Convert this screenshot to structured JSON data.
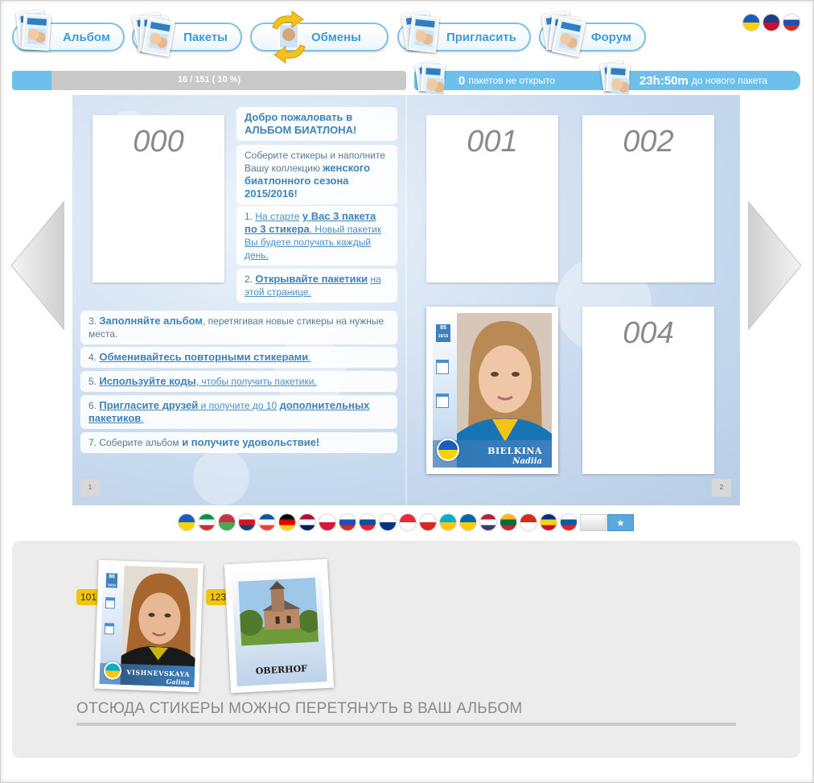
{
  "nav": {
    "album": "Альбом",
    "packs": "Пакеты",
    "exchanges": "Обмены",
    "invite": "Пригласить",
    "forum": "Форум"
  },
  "languages": [
    {
      "name": "ukraine-flag-icon",
      "colors": [
        "#1a5dc0",
        "#f7d300"
      ]
    },
    {
      "name": "uk-flag-icon",
      "colors": [
        "#1b3f8a",
        "#c8102e"
      ]
    },
    {
      "name": "russia-flag-icon",
      "colors": [
        "#ffffff",
        "#1d4fb8",
        "#d52b1e"
      ]
    }
  ],
  "progress": {
    "text": "16 / 151 ( 10 %)",
    "fraction": 0.1
  },
  "packs_status": {
    "count": "0",
    "label": "пакетов не открыто"
  },
  "timer": {
    "value": "23h:50m",
    "label": "до нового пакета"
  },
  "album": {
    "slots": {
      "s000": "000",
      "s001": "001",
      "s002": "002",
      "s004": "004"
    },
    "welcome": {
      "title": "Добро пожаловать в АЛЬБОМ БИАТЛОНА!",
      "intro_plain": "Соберите стикеры и наполните Вашу коллекцию",
      "intro_bold": "женского биатлонного сезона 2015/2016!"
    },
    "steps": {
      "s1_num": "1.",
      "s1_link1": "На старте",
      "s1_bold": "у Вас 3 пакета по 3 стикера",
      "s1_link2": ". Новый пакетик Вы будете получать каждый день.",
      "s2_num": "2.",
      "s2_bold": "Открывайте пакетики",
      "s2_link": "на этой странице.",
      "s3_num": "3.",
      "s3_bold": "Заполняйте альбом",
      "s3_rest": ", перетягивая новые стикеры на нужные места.",
      "s4_num": "4.",
      "s4_bold": "Обменивайтесь повторными стикерами",
      "s4_rest": ".",
      "s5_num": "5.",
      "s5_bold": "Используйте коды",
      "s5_rest": ", чтобы получить пакетики.",
      "s6_num": "6.",
      "s6_bold": "Пригласите друзей",
      "s6_rest": " и получите до 10",
      "s6_bold2": "дополнительных пакетиков",
      "s6_end": ".",
      "s7_plain": "7. Соберите альбом",
      "s7_bold": " и получите удовольствие!"
    },
    "page_left": "1",
    "page_right": "2",
    "sticker_003": {
      "number": "85",
      "sub": "16/16",
      "surname": "BIELKINA",
      "given": "Nadiia",
      "country_colors": [
        "#1a5dc0",
        "#f7d300"
      ]
    }
  },
  "country_flags": [
    {
      "name": "ukraine-flag-icon",
      "colors": [
        "#1a5dc0",
        "#f7d300"
      ]
    },
    {
      "name": "italy-flag-icon",
      "colors": [
        "#009246",
        "#ffffff",
        "#ce2b37"
      ]
    },
    {
      "name": "belarus-flag-icon",
      "colors": [
        "#c8313e",
        "#4aa657"
      ]
    },
    {
      "name": "czech-flag-icon",
      "colors": [
        "#ffffff",
        "#d7141a",
        "#11457e"
      ]
    },
    {
      "name": "france-flag-icon",
      "colors": [
        "#0055a4",
        "#ffffff",
        "#ef4135"
      ]
    },
    {
      "name": "germany-flag-icon",
      "colors": [
        "#000000",
        "#dd0000",
        "#ffce00"
      ]
    },
    {
      "name": "norway-flag-icon",
      "colors": [
        "#ba0c2f",
        "#ffffff",
        "#00205b"
      ]
    },
    {
      "name": "poland-flag-icon",
      "colors": [
        "#ffffff",
        "#dc143c"
      ]
    },
    {
      "name": "russia-flag-icon",
      "colors": [
        "#ffffff",
        "#1d4fb8",
        "#d52b1e"
      ]
    },
    {
      "name": "slovakia-flag-icon",
      "colors": [
        "#ffffff",
        "#0b4ea2",
        "#ee1c25"
      ]
    },
    {
      "name": "finland-flag-icon",
      "colors": [
        "#ffffff",
        "#003580"
      ]
    },
    {
      "name": "austria-flag-icon",
      "colors": [
        "#ed2939",
        "#ffffff"
      ]
    },
    {
      "name": "canada-flag-icon",
      "colors": [
        "#ffffff",
        "#d52b1e"
      ]
    },
    {
      "name": "kazakhstan-flag-icon",
      "colors": [
        "#00afca",
        "#fec50c"
      ]
    },
    {
      "name": "sweden-flag-icon",
      "colors": [
        "#006aa7",
        "#fecc00"
      ]
    },
    {
      "name": "usa-flag-icon",
      "colors": [
        "#b22234",
        "#ffffff",
        "#3c3b6e"
      ]
    },
    {
      "name": "lithuania-flag-icon",
      "colors": [
        "#fdb913",
        "#006a44",
        "#c1272d"
      ]
    },
    {
      "name": "switzerland-flag-icon",
      "colors": [
        "#d52b1e",
        "#ffffff"
      ]
    },
    {
      "name": "romania-flag-icon",
      "colors": [
        "#002b7f",
        "#fcd116",
        "#ce1126"
      ]
    },
    {
      "name": "slovenia-flag-icon",
      "colors": [
        "#ffffff",
        "#005da4",
        "#ed1c24"
      ]
    }
  ],
  "tray": {
    "stickers": [
      {
        "count": "101",
        "number": "86",
        "sub": "16/16",
        "surname": "VISHNEVSKAYA",
        "given": "Galina",
        "country_colors": [
          "#00afca",
          "#fec50c"
        ]
      },
      {
        "count": "123",
        "caption": "OBERHOF"
      }
    ],
    "hint": "ОТСЮДА СТИКЕРЫ МОЖНО ПЕРЕТЯНУТЬ В ВАШ АЛЬБОМ"
  },
  "colors": {
    "accent": "#3d9bd6",
    "progress_fill": "#6ec0ec",
    "badge": "#f2c30f"
  }
}
